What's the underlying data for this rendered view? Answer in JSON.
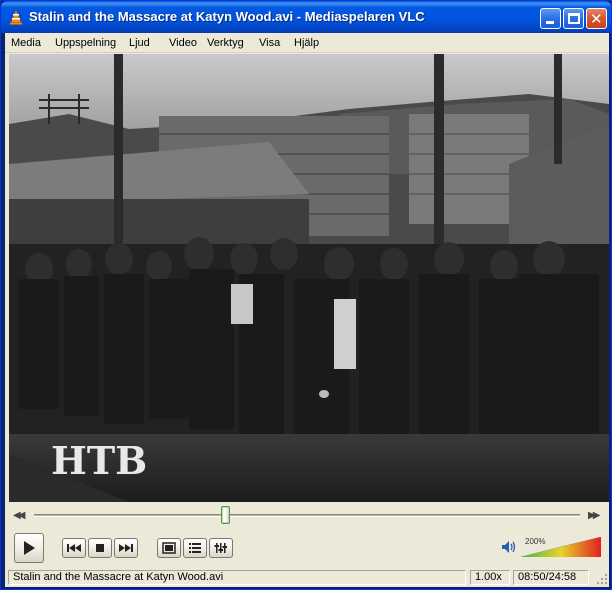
{
  "window": {
    "title": "Stalin and the Massacre at Katyn Wood.avi - Mediaspelaren VLC"
  },
  "menu": [
    {
      "label": "Media"
    },
    {
      "label": "Uppspelning"
    },
    {
      "label": "Ljud"
    },
    {
      "label": "Video"
    },
    {
      "label": "Verktyg"
    },
    {
      "label": "Visa"
    },
    {
      "label": "Hjälp"
    }
  ],
  "video": {
    "watermark": "HTB"
  },
  "seek": {
    "position_fraction": 0.35
  },
  "controls": {
    "play": {
      "icon": "play-icon"
    },
    "previous": {
      "icon": "previous-icon"
    },
    "stop": {
      "icon": "stop-icon"
    },
    "next": {
      "icon": "next-icon"
    },
    "fullscreen": {
      "icon": "fullscreen-icon"
    },
    "playlist": {
      "icon": "playlist-icon"
    },
    "extended": {
      "icon": "extended-settings-icon"
    }
  },
  "volume": {
    "label": "200%",
    "level_fraction": 1.0,
    "icon": "speaker-icon"
  },
  "status": {
    "filename": "Stalin and the Massacre at Katyn Wood.avi",
    "speed": "1.00x",
    "time": "08:50/24:58"
  },
  "colors": {
    "titlebar": "#0153dc",
    "client": "#ece9d8",
    "close_button": "#d75530"
  }
}
